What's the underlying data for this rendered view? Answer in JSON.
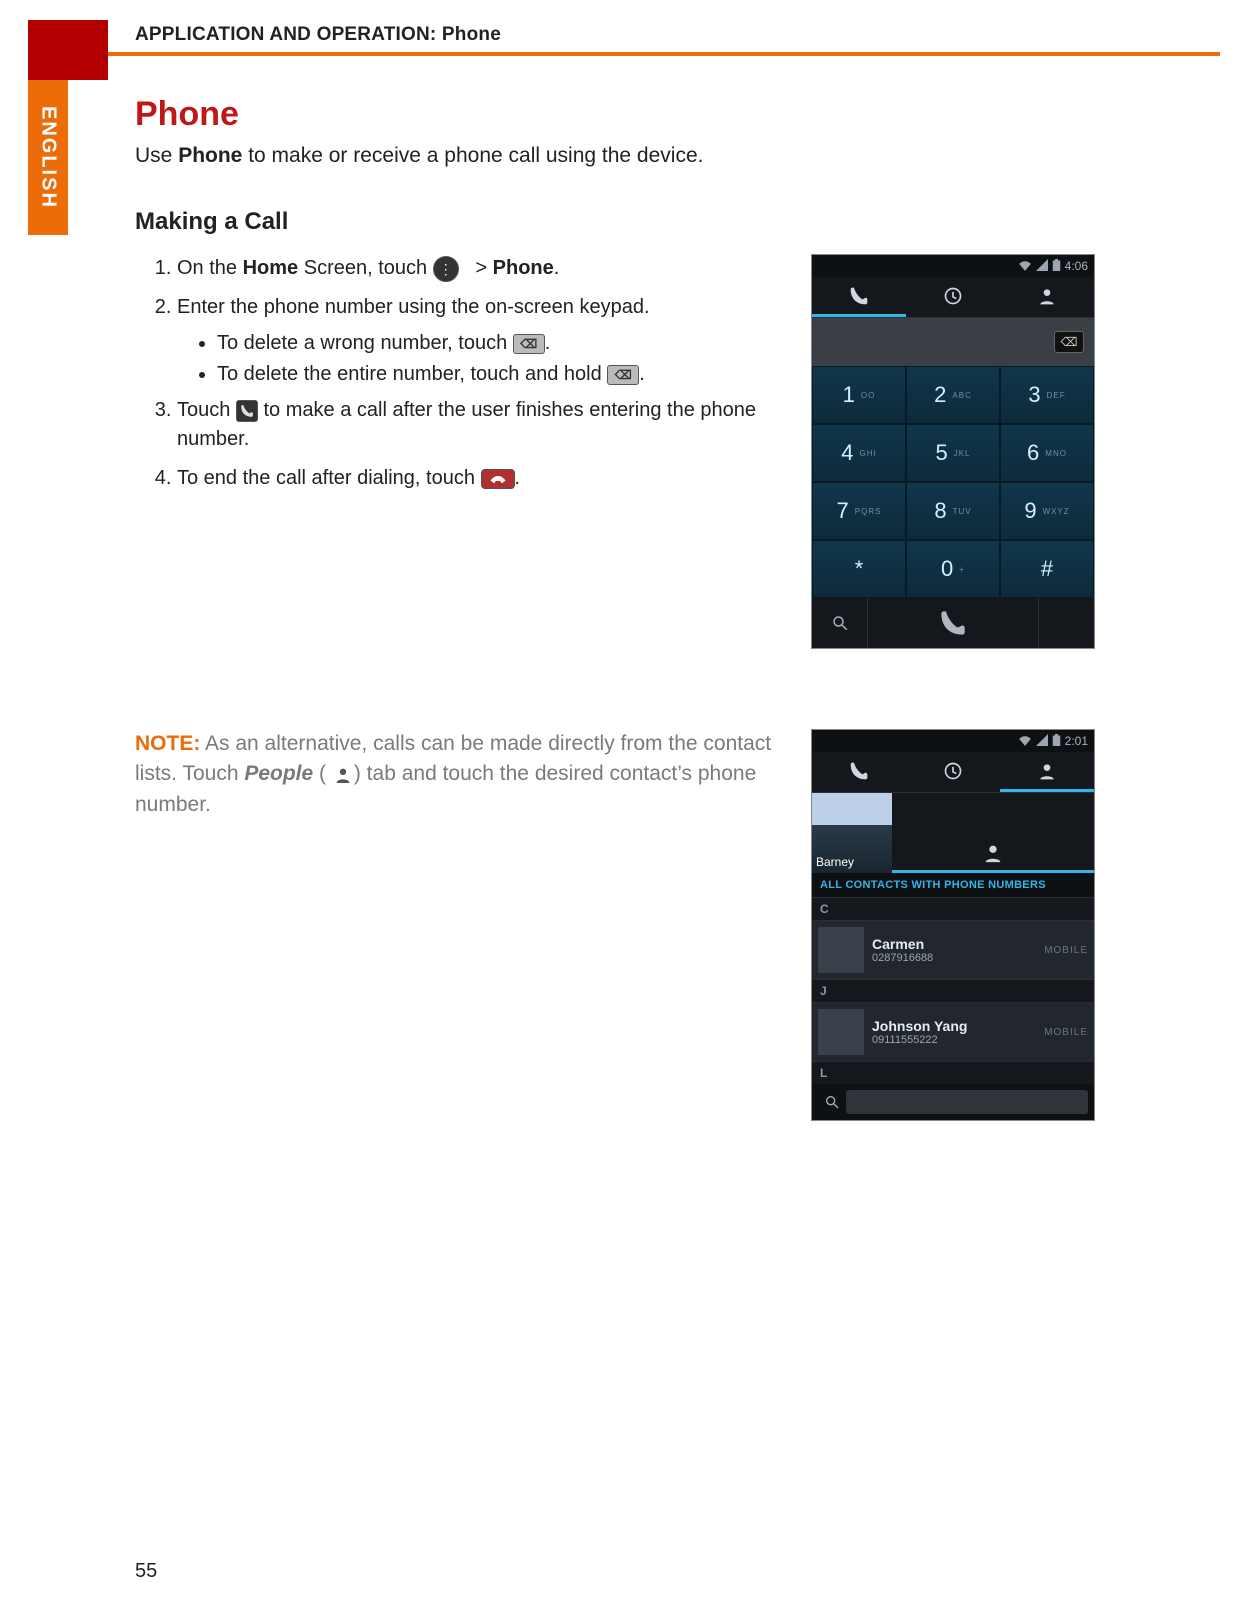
{
  "header": {
    "chapter": "APPLICATION AND OPERATION: Phone"
  },
  "language_tab": "ENGLISH",
  "topic": {
    "title": "Phone",
    "intro_prefix": "Use ",
    "intro_bold": "Phone",
    "intro_suffix": " to make or receive a phone call using the device."
  },
  "making_call": {
    "heading": "Making a Call",
    "step1": {
      "a": "On the ",
      "b": "Home",
      "c": " Screen, touch ",
      "d": " > ",
      "e": "Phone",
      "f": "."
    },
    "step2": "Enter the phone number using the on-screen keypad.",
    "sub1_a": "To delete a wrong number, touch ",
    "sub1_b": ".",
    "sub2_a": "To delete the entire number, touch and hold ",
    "sub2_b": ".",
    "step3_a": "Touch ",
    "step3_b": " to make a call after the user finishes entering the phone number.",
    "step4_a": "To end the call after dialing, touch ",
    "step4_b": "."
  },
  "note": {
    "label": "NOTE:",
    "a": " As an alternative, calls can be made directly from the contact lists. Touch ",
    "people": "People",
    "b": " ( ",
    "c": ") tab and touch the desired contact’s phone number."
  },
  "dialer": {
    "time": "4:06",
    "keys": [
      {
        "n": "1",
        "s": "OO"
      },
      {
        "n": "2",
        "s": "ABC"
      },
      {
        "n": "3",
        "s": "DEF"
      },
      {
        "n": "4",
        "s": "GHI"
      },
      {
        "n": "5",
        "s": "JKL"
      },
      {
        "n": "6",
        "s": "MNO"
      },
      {
        "n": "7",
        "s": "PQRS"
      },
      {
        "n": "8",
        "s": "TUV"
      },
      {
        "n": "9",
        "s": "WXYZ"
      },
      {
        "n": "*",
        "s": ""
      },
      {
        "n": "0",
        "s": "+"
      },
      {
        "n": "#",
        "s": ""
      }
    ]
  },
  "contacts": {
    "time": "2:01",
    "profile_name": "Barney",
    "section": "ALL CONTACTS WITH PHONE NUMBERS",
    "groups": [
      {
        "letter": "C",
        "items": [
          {
            "name": "Carmen",
            "number": "0287916688",
            "type": "MOBILE"
          }
        ]
      },
      {
        "letter": "J",
        "items": [
          {
            "name": "Johnson Yang",
            "number": "09111555222",
            "type": "MOBILE"
          }
        ]
      },
      {
        "letter": "L",
        "items": []
      }
    ]
  },
  "page_number": "55"
}
